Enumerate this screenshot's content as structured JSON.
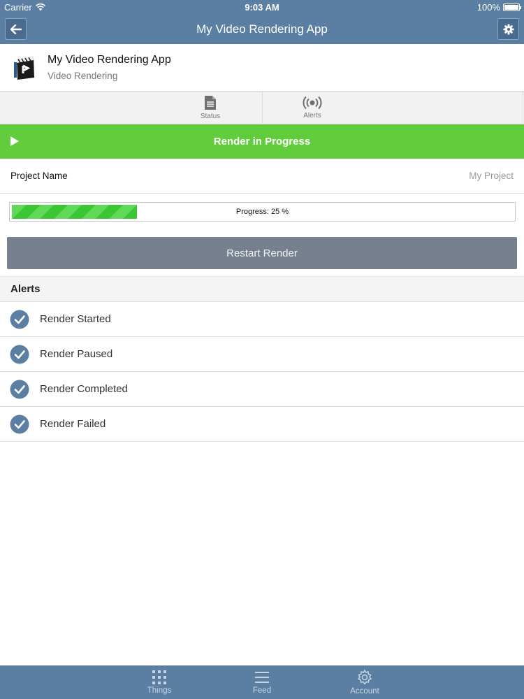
{
  "status_bar": {
    "carrier": "Carrier",
    "time": "9:03 AM",
    "battery": "100%"
  },
  "nav": {
    "title": "My Video Rendering App",
    "back_icon": "back-arrow-icon",
    "settings_icon": "gear-icon"
  },
  "app_header": {
    "name": "My Video Rendering App",
    "subtitle": "Video Rendering"
  },
  "tabs": [
    {
      "label": "Status",
      "icon": "document-icon"
    },
    {
      "label": "Alerts",
      "icon": "broadcast-icon"
    }
  ],
  "banner": {
    "text": "Render in Progress",
    "icon": "play-icon",
    "color": "#62cd3c"
  },
  "project": {
    "label": "Project Name",
    "value": "My Project"
  },
  "progress": {
    "text": "Progress: 25 %",
    "fraction": 0.25
  },
  "restart_button": {
    "label": "Restart Render"
  },
  "alerts": {
    "header": "Alerts",
    "items": [
      {
        "label": "Render Started",
        "checked": true
      },
      {
        "label": "Render Paused",
        "checked": true
      },
      {
        "label": "Render Completed",
        "checked": true
      },
      {
        "label": "Render Failed",
        "checked": true
      }
    ]
  },
  "bottom_tabs": [
    {
      "label": "Things",
      "icon": "grid-icon"
    },
    {
      "label": "Feed",
      "icon": "menu-lines-icon"
    },
    {
      "label": "Account",
      "icon": "gear-icon"
    }
  ],
  "colors": {
    "brand": "#5b7fa3",
    "success": "#62cd3c",
    "button": "#77808f"
  }
}
